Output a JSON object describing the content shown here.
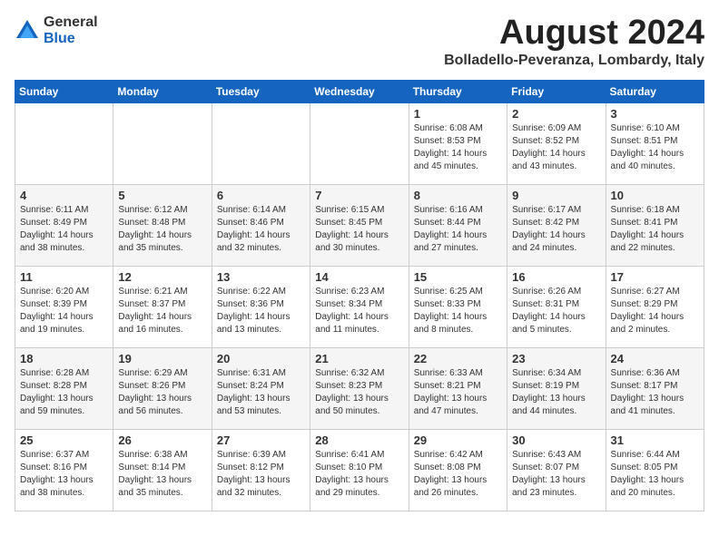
{
  "header": {
    "logo_general": "General",
    "logo_blue": "Blue",
    "month_title": "August 2024",
    "location": "Bolladello-Peveranza, Lombardy, Italy"
  },
  "weekdays": [
    "Sunday",
    "Monday",
    "Tuesday",
    "Wednesday",
    "Thursday",
    "Friday",
    "Saturday"
  ],
  "weeks": [
    [
      {
        "day": "",
        "info": ""
      },
      {
        "day": "",
        "info": ""
      },
      {
        "day": "",
        "info": ""
      },
      {
        "day": "",
        "info": ""
      },
      {
        "day": "1",
        "info": "Sunrise: 6:08 AM\nSunset: 8:53 PM\nDaylight: 14 hours\nand 45 minutes."
      },
      {
        "day": "2",
        "info": "Sunrise: 6:09 AM\nSunset: 8:52 PM\nDaylight: 14 hours\nand 43 minutes."
      },
      {
        "day": "3",
        "info": "Sunrise: 6:10 AM\nSunset: 8:51 PM\nDaylight: 14 hours\nand 40 minutes."
      }
    ],
    [
      {
        "day": "4",
        "info": "Sunrise: 6:11 AM\nSunset: 8:49 PM\nDaylight: 14 hours\nand 38 minutes."
      },
      {
        "day": "5",
        "info": "Sunrise: 6:12 AM\nSunset: 8:48 PM\nDaylight: 14 hours\nand 35 minutes."
      },
      {
        "day": "6",
        "info": "Sunrise: 6:14 AM\nSunset: 8:46 PM\nDaylight: 14 hours\nand 32 minutes."
      },
      {
        "day": "7",
        "info": "Sunrise: 6:15 AM\nSunset: 8:45 PM\nDaylight: 14 hours\nand 30 minutes."
      },
      {
        "day": "8",
        "info": "Sunrise: 6:16 AM\nSunset: 8:44 PM\nDaylight: 14 hours\nand 27 minutes."
      },
      {
        "day": "9",
        "info": "Sunrise: 6:17 AM\nSunset: 8:42 PM\nDaylight: 14 hours\nand 24 minutes."
      },
      {
        "day": "10",
        "info": "Sunrise: 6:18 AM\nSunset: 8:41 PM\nDaylight: 14 hours\nand 22 minutes."
      }
    ],
    [
      {
        "day": "11",
        "info": "Sunrise: 6:20 AM\nSunset: 8:39 PM\nDaylight: 14 hours\nand 19 minutes."
      },
      {
        "day": "12",
        "info": "Sunrise: 6:21 AM\nSunset: 8:37 PM\nDaylight: 14 hours\nand 16 minutes."
      },
      {
        "day": "13",
        "info": "Sunrise: 6:22 AM\nSunset: 8:36 PM\nDaylight: 14 hours\nand 13 minutes."
      },
      {
        "day": "14",
        "info": "Sunrise: 6:23 AM\nSunset: 8:34 PM\nDaylight: 14 hours\nand 11 minutes."
      },
      {
        "day": "15",
        "info": "Sunrise: 6:25 AM\nSunset: 8:33 PM\nDaylight: 14 hours\nand 8 minutes."
      },
      {
        "day": "16",
        "info": "Sunrise: 6:26 AM\nSunset: 8:31 PM\nDaylight: 14 hours\nand 5 minutes."
      },
      {
        "day": "17",
        "info": "Sunrise: 6:27 AM\nSunset: 8:29 PM\nDaylight: 14 hours\nand 2 minutes."
      }
    ],
    [
      {
        "day": "18",
        "info": "Sunrise: 6:28 AM\nSunset: 8:28 PM\nDaylight: 13 hours\nand 59 minutes."
      },
      {
        "day": "19",
        "info": "Sunrise: 6:29 AM\nSunset: 8:26 PM\nDaylight: 13 hours\nand 56 minutes."
      },
      {
        "day": "20",
        "info": "Sunrise: 6:31 AM\nSunset: 8:24 PM\nDaylight: 13 hours\nand 53 minutes."
      },
      {
        "day": "21",
        "info": "Sunrise: 6:32 AM\nSunset: 8:23 PM\nDaylight: 13 hours\nand 50 minutes."
      },
      {
        "day": "22",
        "info": "Sunrise: 6:33 AM\nSunset: 8:21 PM\nDaylight: 13 hours\nand 47 minutes."
      },
      {
        "day": "23",
        "info": "Sunrise: 6:34 AM\nSunset: 8:19 PM\nDaylight: 13 hours\nand 44 minutes."
      },
      {
        "day": "24",
        "info": "Sunrise: 6:36 AM\nSunset: 8:17 PM\nDaylight: 13 hours\nand 41 minutes."
      }
    ],
    [
      {
        "day": "25",
        "info": "Sunrise: 6:37 AM\nSunset: 8:16 PM\nDaylight: 13 hours\nand 38 minutes."
      },
      {
        "day": "26",
        "info": "Sunrise: 6:38 AM\nSunset: 8:14 PM\nDaylight: 13 hours\nand 35 minutes."
      },
      {
        "day": "27",
        "info": "Sunrise: 6:39 AM\nSunset: 8:12 PM\nDaylight: 13 hours\nand 32 minutes."
      },
      {
        "day": "28",
        "info": "Sunrise: 6:41 AM\nSunset: 8:10 PM\nDaylight: 13 hours\nand 29 minutes."
      },
      {
        "day": "29",
        "info": "Sunrise: 6:42 AM\nSunset: 8:08 PM\nDaylight: 13 hours\nand 26 minutes."
      },
      {
        "day": "30",
        "info": "Sunrise: 6:43 AM\nSunset: 8:07 PM\nDaylight: 13 hours\nand 23 minutes."
      },
      {
        "day": "31",
        "info": "Sunrise: 6:44 AM\nSunset: 8:05 PM\nDaylight: 13 hours\nand 20 minutes."
      }
    ]
  ]
}
